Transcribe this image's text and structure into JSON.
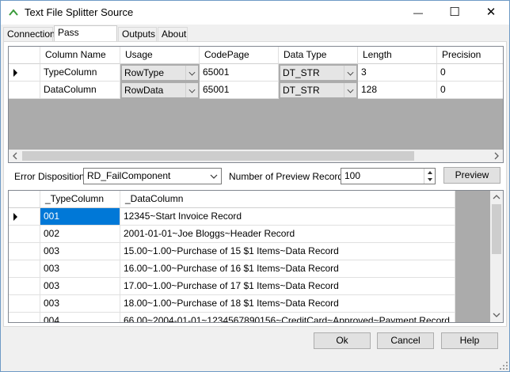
{
  "window": {
    "title": "Text File Splitter Source",
    "minimize": "—",
    "maximize": "☐",
    "close": "✕"
  },
  "tabs": [
    "Connection",
    "Pass Through",
    "Outputs",
    "About"
  ],
  "columns_grid": {
    "headers": [
      "Column Name",
      "Usage",
      "CodePage",
      "Data Type",
      "Length",
      "Precision"
    ],
    "rows": [
      {
        "name": "TypeColumn",
        "usage": "RowType",
        "codepage": "65001",
        "datatype": "DT_STR",
        "length": "3",
        "precision": "0"
      },
      {
        "name": "DataColumn",
        "usage": "RowData",
        "codepage": "65001",
        "datatype": "DT_STR",
        "length": "128",
        "precision": "0"
      }
    ]
  },
  "error_disposition": {
    "label": "Error Disposition",
    "value": "RD_FailComponent"
  },
  "preview_records": {
    "label": "Number of Preview Records",
    "value": "100"
  },
  "preview_button": "Preview",
  "preview_grid": {
    "headers": [
      "_TypeColumn",
      "_DataColumn"
    ],
    "rows": [
      {
        "type": "001",
        "data": "12345~Start Invoice Record"
      },
      {
        "type": "002",
        "data": "2001-01-01~Joe Bloggs~Header Record"
      },
      {
        "type": "003",
        "data": "15.00~1.00~Purchase of 15 $1 Items~Data Record"
      },
      {
        "type": "003",
        "data": "16.00~1.00~Purchase of 16 $1 Items~Data Record"
      },
      {
        "type": "003",
        "data": "17.00~1.00~Purchase of 17 $1 Items~Data Record"
      },
      {
        "type": "003",
        "data": "18.00~1.00~Purchase of 18 $1 Items~Data Record"
      },
      {
        "type": "004",
        "data": "66.00~2004-01-01~1234567890156~CreditCard~Approved~Payment Record"
      }
    ]
  },
  "buttons": {
    "ok": "Ok",
    "cancel": "Cancel",
    "help": "Help"
  }
}
